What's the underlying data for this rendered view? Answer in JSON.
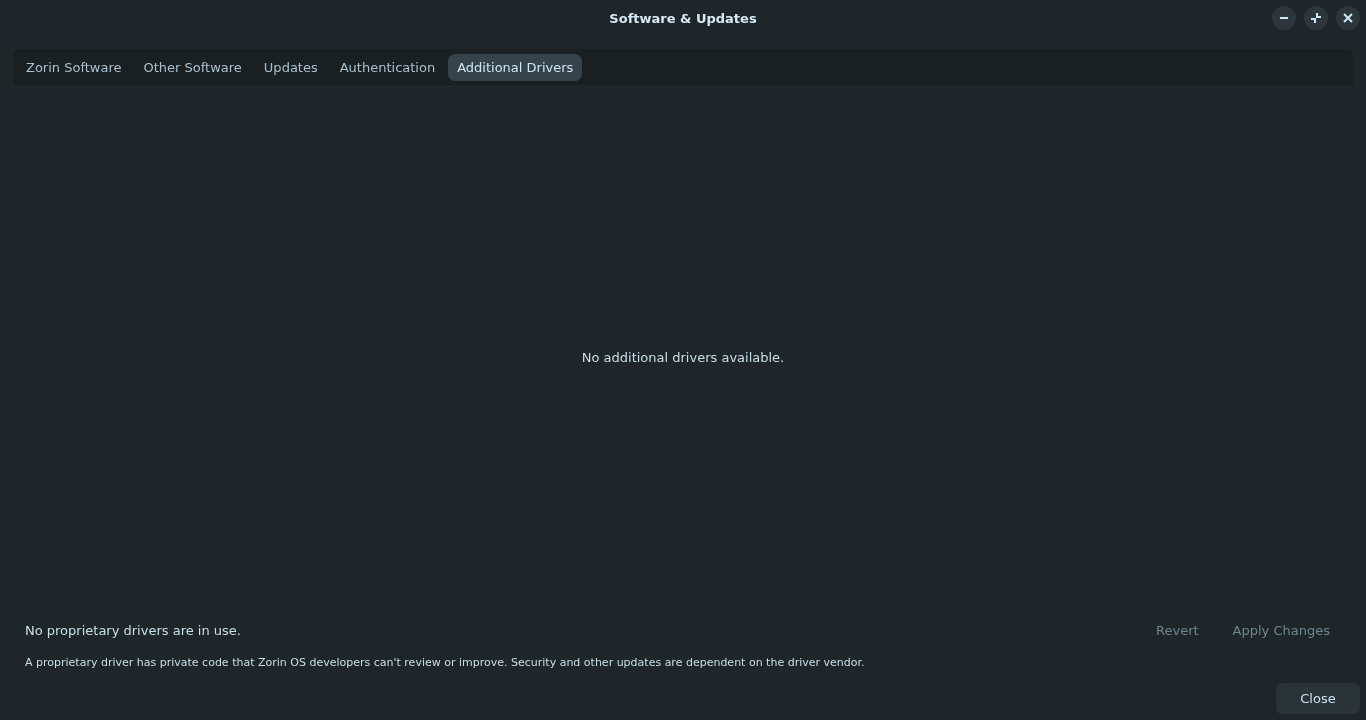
{
  "window": {
    "title": "Software & Updates"
  },
  "tabs": [
    {
      "label": "Zorin Software",
      "selected": false
    },
    {
      "label": "Other Software",
      "selected": false
    },
    {
      "label": "Updates",
      "selected": false
    },
    {
      "label": "Authentication",
      "selected": false
    },
    {
      "label": "Additional Drivers",
      "selected": true
    }
  ],
  "content": {
    "message": "No additional drivers available."
  },
  "status": {
    "text": "No proprietary drivers are in use.",
    "note": "A proprietary driver has private code that Zorin OS developers can't review or improve. Security and other updates are dependent on the driver vendor."
  },
  "actions": [
    {
      "label": "Revert",
      "disabled": true
    },
    {
      "label": "Apply Changes",
      "disabled": true
    }
  ],
  "close_button": {
    "label": "Close"
  }
}
